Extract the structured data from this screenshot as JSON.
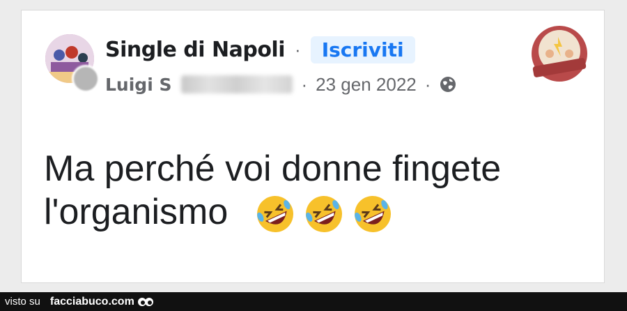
{
  "post": {
    "group_name": "Single di Napoli",
    "separator": "·",
    "subscribe_label": "Iscriviti",
    "author": "Luigi S",
    "date_separator": "·",
    "date": "23 gen 2022",
    "privacy_icon": "globe-icon",
    "text_line1": "Ma perché voi donne fingete",
    "text_line2": "l'organismo",
    "emojis": [
      "rolling-on-floor-laughing",
      "rolling-on-floor-laughing",
      "rolling-on-floor-laughing"
    ]
  },
  "footer": {
    "visto_label": "visto su",
    "site_label": "facciabuco.com"
  },
  "colors": {
    "accent": "#1877f2",
    "subscribe_bg": "#e7f3ff",
    "text": "#1c1e21",
    "secondary_text": "#65676b",
    "footer_bg": "#111111"
  }
}
